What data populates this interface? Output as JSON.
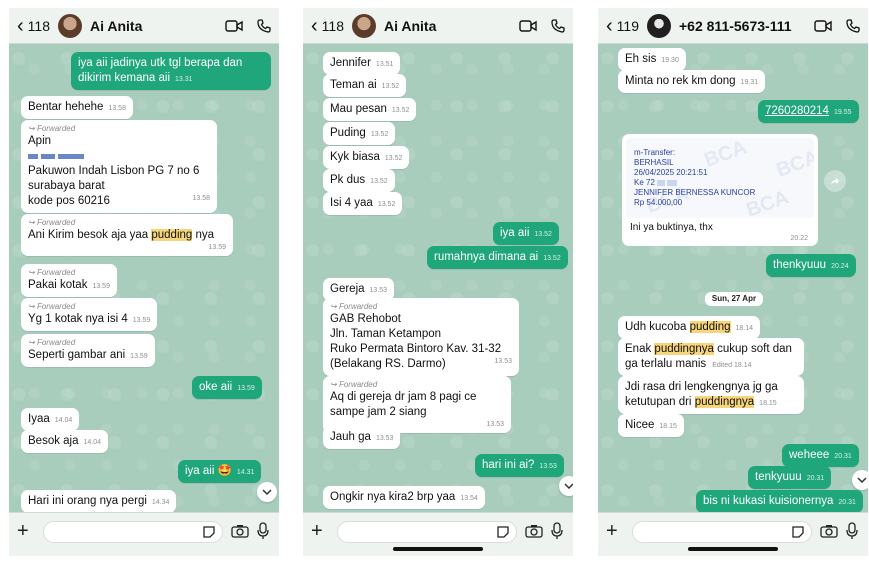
{
  "colors": {
    "outgoing": "#1fa67a",
    "incoming": "#ffffff",
    "chat_bg": "#a9cdbd",
    "highlight": "#f7d57a"
  },
  "p1": {
    "header": {
      "back_icon": "chevron-left-icon",
      "count": "118",
      "name": "Ai Anita"
    },
    "m1": {
      "text": "iya aii jadinya utk tgl berapa dan dikirim kemana aii",
      "time": "13.31"
    },
    "m2": {
      "text": "Bentar hehehe",
      "time": "13.58"
    },
    "m3": {
      "fwd": "Forwarded",
      "line1": "Apin",
      "line2": "Pakuwon Indah Lisbon PG 7 no 6",
      "line3": "surabaya barat",
      "line4": "kode pos 60216",
      "time": "13.58"
    },
    "m4": {
      "fwd": "Forwarded",
      "pre": "Ani Kirim besok aja yaa ",
      "hl": "pudding",
      "post": " nya",
      "time": "13.59"
    },
    "m5": {
      "fwd": "Forwarded",
      "text": "Pakai kotak",
      "time": "13.59"
    },
    "m6": {
      "fwd": "Forwarded",
      "text": "Yg 1 kotak nya isi 4",
      "time": "13.59"
    },
    "m7": {
      "fwd": "Forwarded",
      "text": "Seperti gambar ani",
      "time": "13.59"
    },
    "m8": {
      "text": "oke aii",
      "time": "13.59"
    },
    "m9": {
      "text": "Iyaa",
      "time": "14.04"
    },
    "m10": {
      "text": "Besok aja",
      "time": "14.04"
    },
    "m11": {
      "text": "iya aii 🤩",
      "time": "14.31"
    },
    "m12": {
      "text": "Hari ini orang nya pergi",
      "time": "14.34"
    }
  },
  "p2": {
    "header": {
      "count": "118",
      "name": "Ai Anita"
    },
    "m1": {
      "text": "Jennifer",
      "time": "13.51"
    },
    "m2": {
      "text": "Teman ai",
      "time": "13.52"
    },
    "m3": {
      "text": "Mau pesan",
      "time": "13.52"
    },
    "m4": {
      "text": "Puding",
      "time": "13.52"
    },
    "m5": {
      "text": "Kyk biasa",
      "time": "13.52"
    },
    "m6": {
      "text": "Pk dus",
      "time": "13.52"
    },
    "m7": {
      "text": "Isi 4 yaa",
      "time": "13.52"
    },
    "m8": {
      "text": "iya aii",
      "time": "13.52"
    },
    "m9": {
      "text": "rumahnya dimana ai",
      "time": "13.52"
    },
    "m10": {
      "text": "Gereja",
      "time": "13.53"
    },
    "m11": {
      "fwd": "Forwarded",
      "line1": "GAB Rehobot",
      "line2": "Jln. Taman Ketampon",
      "line3": "Ruko Permata Bintoro Kav. 31-32",
      "line4": "(Belakang RS. Darmo)",
      "time": "13.53"
    },
    "m12": {
      "fwd": "Forwarded",
      "text": "Aq di gereja dr jam 8 pagi ce sampe jam 2 siang",
      "time": "13.53"
    },
    "m13": {
      "text": "Jauh ga",
      "time": "13.53"
    },
    "m14": {
      "text": "hari ini ai?",
      "time": "13.53"
    },
    "m15": {
      "text": "Ongkir nya kira2 brp yaa",
      "time": "13.54"
    }
  },
  "p3": {
    "header": {
      "count": "119",
      "name": "+62 811-5673-111"
    },
    "m1": {
      "text": "Eh sis",
      "time": "19.30"
    },
    "m2": {
      "text": "Minta no rek km dong",
      "time": "19.31"
    },
    "m3": {
      "text": "7260280214",
      "time": "19.55"
    },
    "receipt": {
      "l1": "m-Transfer:",
      "l2": "BERHASIL",
      "l3": "26/04/2025 20:21:51",
      "l4": "Ke 72",
      "l5": "JENNIFER BERNESSA KUNCOR",
      "l6": "Rp 54.000,00",
      "watermark": "BCA",
      "caption": "Ini ya buktinya, thx",
      "time": "20.22"
    },
    "m4": {
      "text": "thenkyuuu",
      "time": "20.24"
    },
    "date": "Sun, 27 Apr",
    "m5": {
      "pre": "Udh kucoba ",
      "hl": "pudding",
      "time": "18.14"
    },
    "m6": {
      "pre": "Enak ",
      "hl": "puddingnya",
      "post": " cukup soft dan ga terlalu manis",
      "edited": "Edited 18.14"
    },
    "m7": {
      "pre": "Jdi rasa dri lengkengnya jg ga ketutupan dri ",
      "hl": "puddingnya",
      "time": "18.15"
    },
    "m8": {
      "text": "Nicee",
      "time": "18.15"
    },
    "m9": {
      "text": "weheee",
      "time": "20.31"
    },
    "m10": {
      "text": "tenkyuuu",
      "time": "20.31"
    },
    "m11": {
      "text": "bis ni kukasi kuisionernya",
      "time": "20.31"
    }
  }
}
